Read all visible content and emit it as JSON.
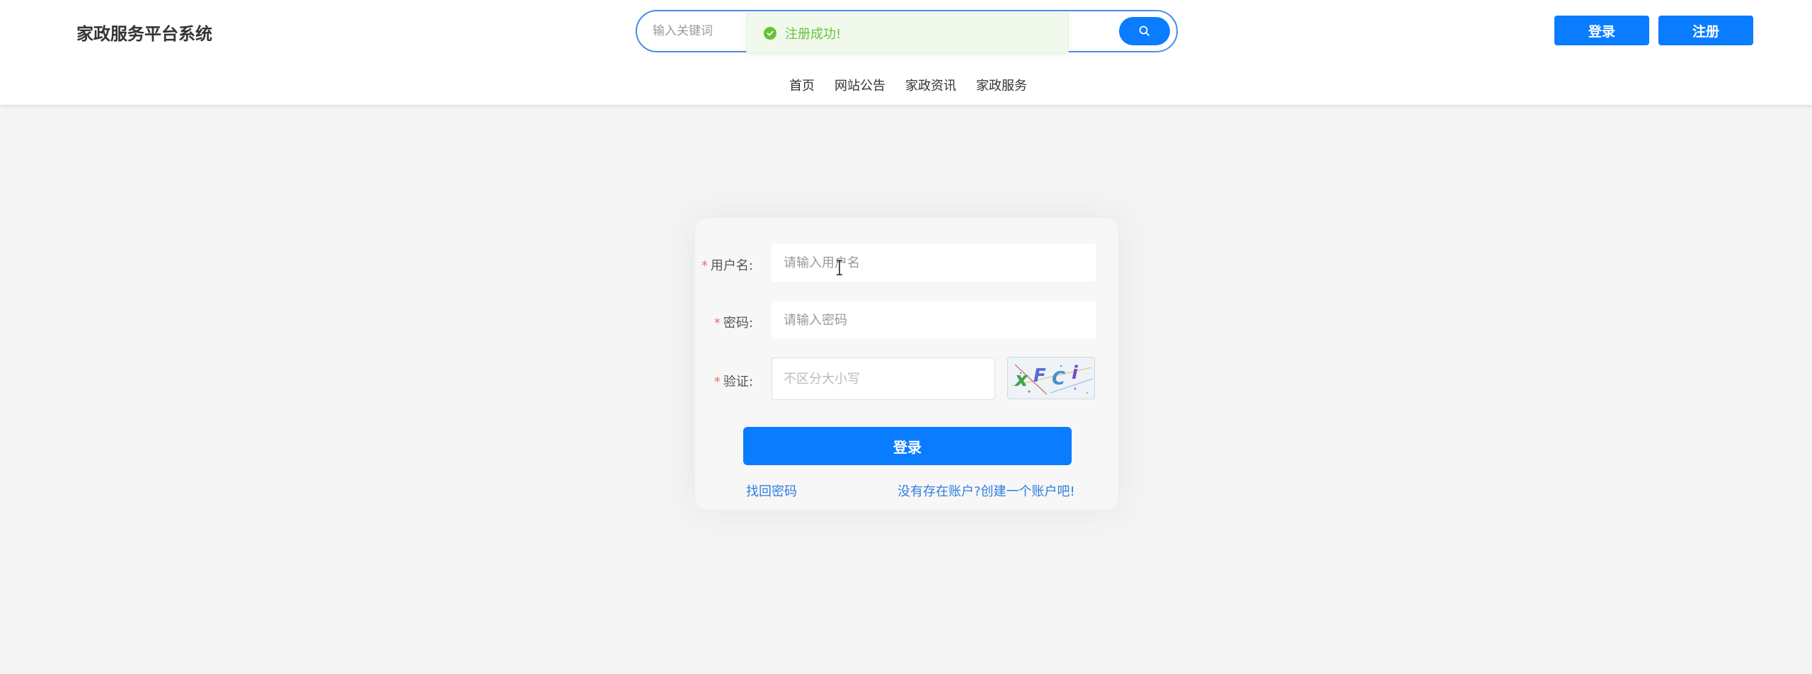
{
  "header": {
    "logo": "家政服务平台系统",
    "search": {
      "placeholder": "输入关键词"
    },
    "login_label": "登录",
    "register_label": "注册"
  },
  "toast": {
    "message": "注册成功!",
    "status": "success",
    "color": "#67c23a"
  },
  "nav": {
    "items": [
      "首页",
      "网站公告",
      "家政资讯",
      "家政服务"
    ]
  },
  "login_form": {
    "username": {
      "label": "用户名:",
      "placeholder": "请输入用户名"
    },
    "password": {
      "label": "密码:",
      "placeholder": "请输入密码"
    },
    "captcha": {
      "label": "验证:",
      "placeholder": "不区分大小写",
      "code": "xFCi"
    },
    "submit_label": "登录",
    "forgot_link": "找回密码",
    "create_account_link": "没有存在账户?创建一个账户吧!"
  },
  "colors": {
    "accent": "#0a7cff",
    "required": "#f56c6c",
    "link": "#2f7de1",
    "background": "#f4f4f4"
  }
}
